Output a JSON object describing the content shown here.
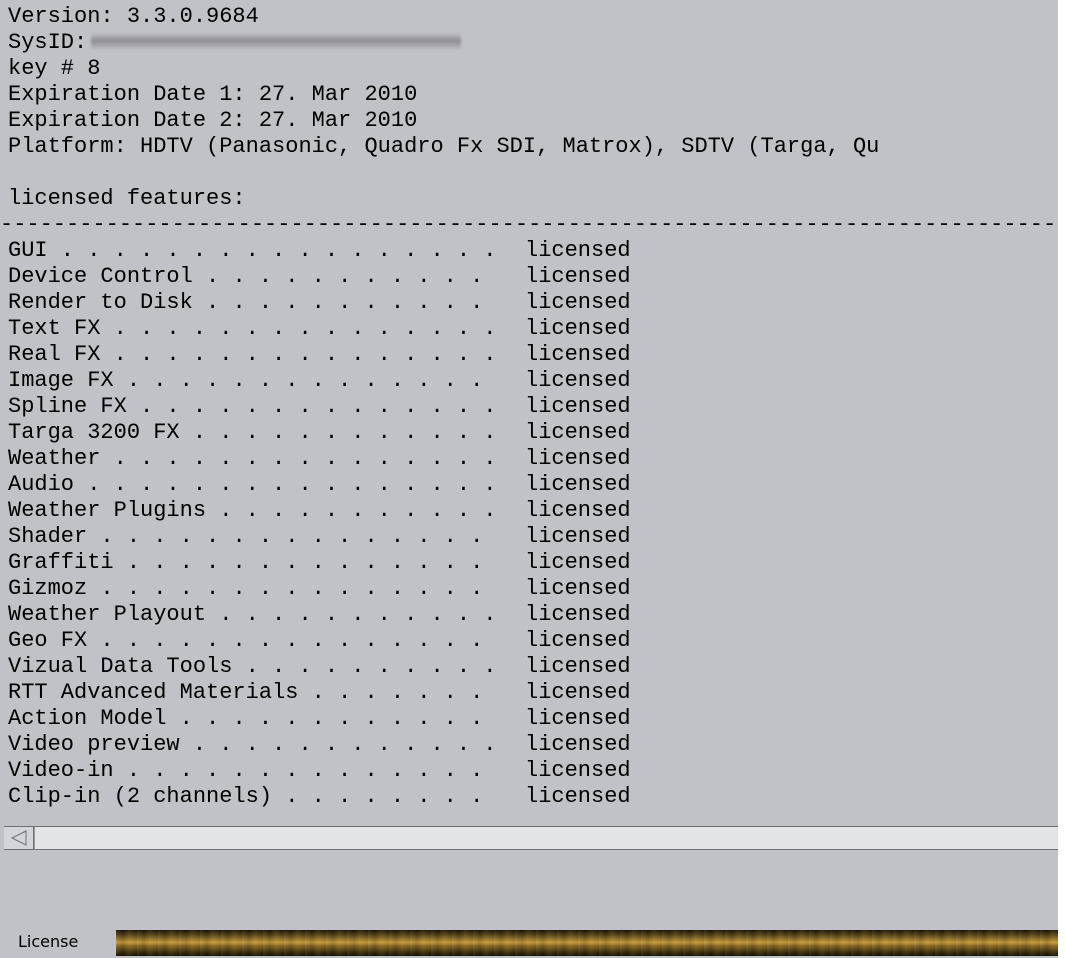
{
  "info": {
    "version": "Version: 3.3.0.9684",
    "sysid_label": "SysID:",
    "key": "key # 8",
    "expiration1": "Expiration Date 1: 27. Mar 2010",
    "expiration2": "Expiration Date 2: 27. Mar 2010",
    "platform": "Platform: HDTV (Panasonic, Quadro Fx SDI, Matrox), SDTV (Targa, Qu",
    "features_header": "licensed features:",
    "separator": "--------------------------------------------------------------------------------------------------------------"
  },
  "features": [
    {
      "name": "GUI",
      "status": "licensed"
    },
    {
      "name": "Device Control",
      "status": "licensed"
    },
    {
      "name": "Render to Disk",
      "status": "licensed"
    },
    {
      "name": "Text FX",
      "status": "licensed"
    },
    {
      "name": "Real FX",
      "status": "licensed"
    },
    {
      "name": "Image FX",
      "status": "licensed"
    },
    {
      "name": "Spline FX",
      "status": "licensed"
    },
    {
      "name": "Targa 3200 FX",
      "status": "licensed"
    },
    {
      "name": "Weather",
      "status": "licensed"
    },
    {
      "name": "Audio",
      "status": "licensed"
    },
    {
      "name": "Weather Plugins",
      "status": "licensed"
    },
    {
      "name": "Shader",
      "status": "licensed"
    },
    {
      "name": "Graffiti",
      "status": "licensed"
    },
    {
      "name": "Gizmoz",
      "status": "licensed"
    },
    {
      "name": "Weather Playout",
      "status": "licensed"
    },
    {
      "name": "Geo FX",
      "status": "licensed"
    },
    {
      "name": "Vizual Data Tools",
      "status": "licensed"
    },
    {
      "name": "RTT Advanced Materials",
      "status": "licensed"
    },
    {
      "name": "Action Model",
      "status": "licensed"
    },
    {
      "name": "Video preview",
      "status": "licensed"
    },
    {
      "name": "Video-in",
      "status": "licensed"
    },
    {
      "name": "Clip-in (2 channels)",
      "status": "licensed"
    }
  ],
  "bottom": {
    "label": "License",
    "progress": 1.0
  },
  "colors": {
    "window_bg": "#c1c2c8",
    "text": "#000000"
  },
  "icons": {
    "scroll_left": "triangle-left-icon"
  }
}
